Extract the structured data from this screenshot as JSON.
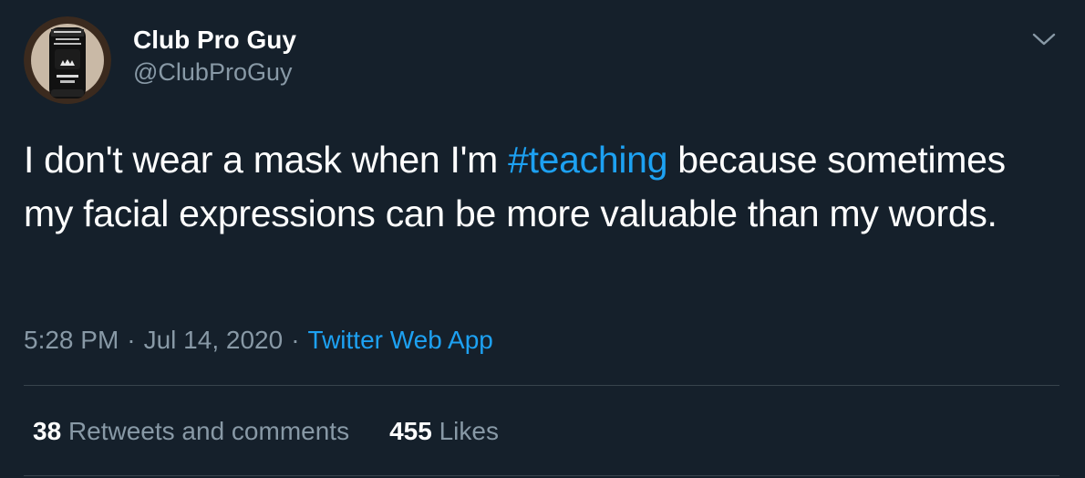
{
  "author": {
    "display_name": "Club Pro Guy",
    "handle": "@ClubProGuy",
    "avatar_icon": "mask-avatar-icon"
  },
  "menu": {
    "icon": "chevron-down-icon"
  },
  "tweet": {
    "text_before": "I don't wear a mask when I'm ",
    "hashtag": "#teaching",
    "text_after": " because sometimes my facial expressions can be more valuable than my words."
  },
  "meta": {
    "time": "5:28 PM",
    "separator": "·",
    "date": "Jul 14, 2020",
    "source": "Twitter Web App"
  },
  "stats": {
    "retweets_count": "38",
    "retweets_label": "Retweets and comments",
    "likes_count": "455",
    "likes_label": "Likes"
  },
  "colors": {
    "background": "#15202b",
    "text": "#ffffff",
    "secondary": "#8899a6",
    "accent": "#1da1f2",
    "divider": "#38444d"
  }
}
